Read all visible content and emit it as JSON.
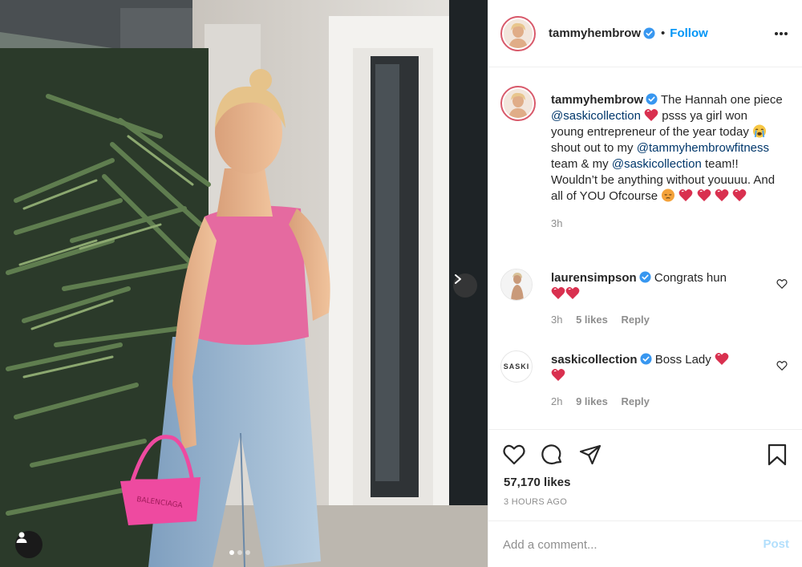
{
  "post": {
    "author": "tammyhembrow",
    "follow_label": "Follow",
    "separator": "•",
    "caption": {
      "username": "tammyhembrow",
      "text_1": "The Hannah one piece",
      "mention_1": "@saskicollection",
      "text_2": "psss ya girl won young entrepreneur of the year today",
      "text_3": "shout out to my",
      "mention_2": "@tammyhembrowfitness",
      "text_4": "team & my",
      "mention_3": "@saskicollection",
      "text_5": "team!! Wouldn’t be anything without youuuu. And all of YOU Ofcourse",
      "time": "3h"
    },
    "comments": [
      {
        "username": "laurensimpson",
        "text": "Congrats hun",
        "time": "3h",
        "likes": "5 likes",
        "reply": "Reply"
      },
      {
        "username": "saskicollection",
        "text": "Boss Lady",
        "time": "2h",
        "likes": "9 likes",
        "reply": "Reply",
        "avatar_text": "SASKI"
      }
    ],
    "likes_count": "57,170 likes",
    "posted_ago": "3 HOURS AGO",
    "comment_placeholder": "Add a comment...",
    "post_label": "Post",
    "photo_bag_text": "BALENCIAGA",
    "carousel": {
      "slides": 3,
      "current": 1
    }
  },
  "icons": {
    "verified": "verified-badge-icon",
    "more": "more-options-icon",
    "like": "heart-icon",
    "comment": "comment-icon",
    "share": "paper-plane-icon",
    "save": "bookmark-icon",
    "next": "chevron-right-icon",
    "tag": "user-tag-icon"
  },
  "colors": {
    "accent": "#0095f6",
    "verified": "#3897f0",
    "mention": "#00376b",
    "muted": "#8e8e8e",
    "post_disabled": "#b2dffc"
  }
}
